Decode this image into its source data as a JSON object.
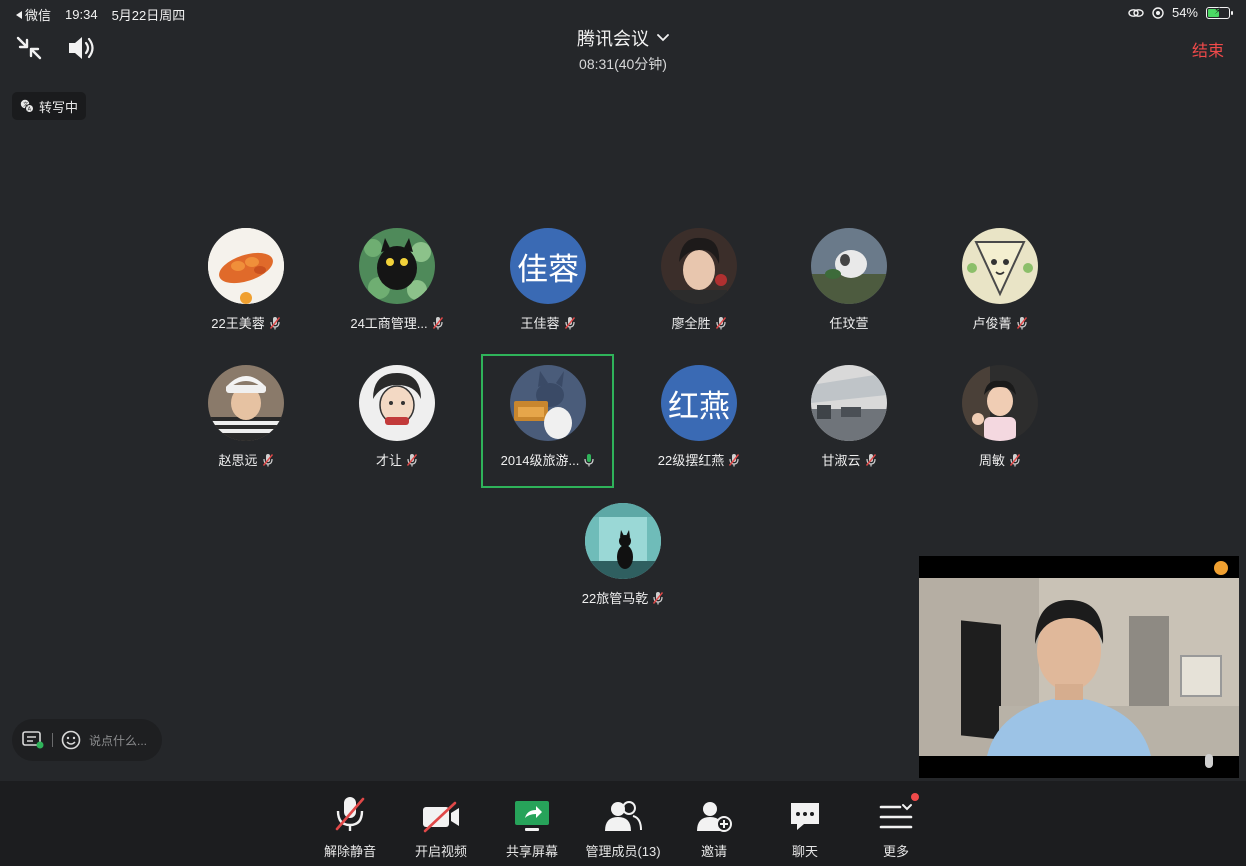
{
  "status_bar": {
    "back_app": "微信",
    "time": "19:34",
    "date": "5月22日周四",
    "battery": "54%"
  },
  "header": {
    "title": "腾讯会议",
    "duration": "08:31(40分钟)",
    "end_label": "结束"
  },
  "transcribe": {
    "label": "转写中"
  },
  "participants": {
    "p1": {
      "name": "22王美蓉",
      "avatar": "photo"
    },
    "p2": {
      "name": "24工商管理...",
      "avatar": "photo"
    },
    "p3": {
      "name": "王佳蓉",
      "avatar_text": "佳蓉"
    },
    "p4": {
      "name": "廖全胜",
      "avatar": "photo"
    },
    "p5": {
      "name": "任玟萱",
      "avatar": "photo"
    },
    "p6": {
      "name": "卢俊菁",
      "avatar": "photo"
    },
    "p7": {
      "name": "赵思远",
      "avatar": "photo"
    },
    "p8": {
      "name": "才让",
      "avatar": "photo"
    },
    "p9": {
      "name": "2014级旅游...",
      "avatar": "photo",
      "speaking": true
    },
    "p10": {
      "name": "22级摆红燕",
      "avatar_text": "红燕"
    },
    "p11": {
      "name": "甘淑云",
      "avatar": "photo"
    },
    "p12": {
      "name": "周敏",
      "avatar": "photo"
    },
    "p13": {
      "name": "22旅管马乾",
      "avatar": "photo"
    }
  },
  "chat": {
    "placeholder": "说点什么..."
  },
  "toolbar": {
    "unmute": "解除静音",
    "start_video": "开启视频",
    "share_screen": "共享屏幕",
    "manage_members": "管理成员(13)",
    "invite": "邀请",
    "chat": "聊天",
    "more": "更多"
  },
  "colors": {
    "background": "#25272a",
    "toolbar": "#1c1d1f",
    "end_red": "#f04a4a",
    "speaking_green": "#2fb35a",
    "text_avatar_blue": "#3a6ab4",
    "share_green": "#27a35a"
  },
  "icons": [
    "back-arrow-icon",
    "link-icon",
    "location-icon",
    "battery-icon",
    "minimize-icon",
    "speaker-icon",
    "chevron-down-icon",
    "transcribe-icon",
    "mic-muted-icon",
    "mic-active-icon",
    "chat-input-icon",
    "emoji-icon",
    "camera-off-icon",
    "share-screen-icon",
    "members-icon",
    "invite-icon",
    "chat-icon",
    "more-icon"
  ]
}
